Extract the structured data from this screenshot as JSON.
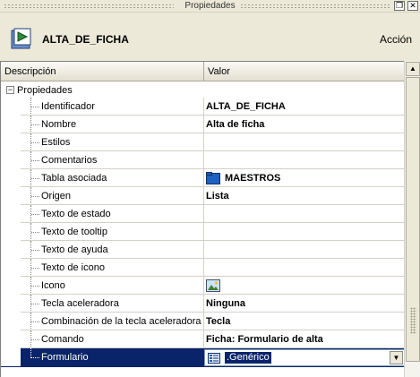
{
  "window": {
    "title": "Propiedades"
  },
  "header": {
    "title": "ALTA_DE_FICHA",
    "action": "Acción",
    "icon": "form-icon"
  },
  "grid": {
    "columns": {
      "description": "Descripción",
      "value": "Valor"
    },
    "group": {
      "label": "Propiedades",
      "toggle": "−"
    },
    "rows": [
      {
        "label": "Identificador",
        "value": "ALTA_DE_FICHA"
      },
      {
        "label": "Nombre",
        "value": "Alta de ficha"
      },
      {
        "label": "Estilos",
        "value": ""
      },
      {
        "label": "Comentarios",
        "value": ""
      },
      {
        "label": "Tabla asociada",
        "value": "MAESTROS",
        "icon": "table-icon"
      },
      {
        "label": "Origen",
        "value": "Lista"
      },
      {
        "label": "Texto de estado",
        "value": ""
      },
      {
        "label": "Texto de tooltip",
        "value": ""
      },
      {
        "label": "Texto de ayuda",
        "value": ""
      },
      {
        "label": "Texto de icono",
        "value": ""
      },
      {
        "label": "Icono",
        "value": "",
        "icon": "image-icon"
      },
      {
        "label": "Tecla aceleradora",
        "value": "Ninguna"
      },
      {
        "label": "Combinación de la tecla aceleradora",
        "value": "Tecla"
      },
      {
        "label": "Comando",
        "value": "Ficha: Formulario de alta"
      },
      {
        "label": "Formulario",
        "value": ".Genérico",
        "selected": true,
        "icon": "form-list-icon"
      }
    ]
  },
  "colors": {
    "selection": "#0a246a",
    "panel": "#ece9d8"
  }
}
